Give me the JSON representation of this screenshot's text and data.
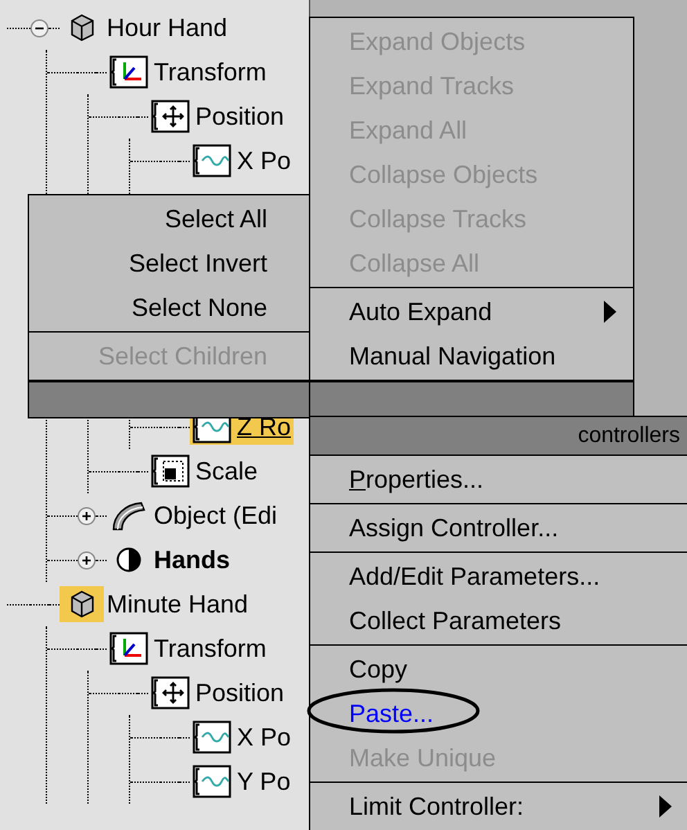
{
  "tree": [
    {
      "label": "Hour Hand",
      "kind": "object",
      "expanded": true,
      "selected": false,
      "focused": false,
      "bold": false,
      "children": [
        {
          "label": "Transform",
          "kind": "transform",
          "selected": false,
          "focused": false,
          "bold": false,
          "children": [
            {
              "label": "Position",
              "kind": "position",
              "selected": false,
              "focused": false,
              "bold": false,
              "children": [
                {
                  "label": "X Po",
                  "kind": "curve",
                  "selected": false,
                  "focused": false,
                  "bold": false
                },
                {
                  "label": "Z Ro",
                  "kind": "curve",
                  "rows_hidden_above": true,
                  "selected": true,
                  "focused": true,
                  "bold": false
                }
              ]
            },
            {
              "label": "Scale",
              "kind": "scale",
              "selected": false,
              "focused": false,
              "bold": false
            }
          ]
        },
        {
          "label": "Object (Edi",
          "kind": "modifier",
          "expanded": false,
          "selected": false,
          "focused": false,
          "bold": false
        },
        {
          "label": "Hands",
          "kind": "group",
          "expanded": false,
          "selected": false,
          "focused": false,
          "bold": true
        }
      ]
    },
    {
      "label": "Minute Hand",
      "kind": "object",
      "selected": true,
      "focused": false,
      "bold": false,
      "children": [
        {
          "label": "Transform",
          "kind": "transform",
          "selected": false,
          "focused": false,
          "bold": false,
          "children": [
            {
              "label": "Position",
              "kind": "position",
              "selected": false,
              "focused": false,
              "bold": false,
              "children": [
                {
                  "label": "X Po",
                  "kind": "curve",
                  "selected": false,
                  "focused": false,
                  "bold": false
                },
                {
                  "label": "Y Po",
                  "kind": "curve",
                  "selected": false,
                  "focused": false,
                  "bold": false
                }
              ]
            }
          ]
        }
      ]
    }
  ],
  "quad_menu": [
    {
      "groups": [
        [
          {
            "label": "Select All",
            "disabled": false,
            "submenu": false,
            "highlighted": false,
            "underline_first": false
          },
          {
            "label": "Select Invert",
            "disabled": false,
            "submenu": false,
            "highlighted": false,
            "underline_first": false
          },
          {
            "label": "Select None",
            "disabled": false,
            "submenu": false,
            "highlighted": false,
            "underline_first": false
          }
        ],
        [
          {
            "label": "Select Children",
            "disabled": true,
            "submenu": false,
            "highlighted": false,
            "underline_first": false
          }
        ]
      ]
    },
    {
      "groups": [
        [
          {
            "label": "Expand Objects",
            "disabled": true,
            "submenu": false,
            "highlighted": false,
            "underline_first": false
          },
          {
            "label": "Expand Tracks",
            "disabled": true,
            "submenu": false,
            "highlighted": false,
            "underline_first": false
          },
          {
            "label": "Expand All",
            "disabled": true,
            "submenu": false,
            "highlighted": false,
            "underline_first": false
          },
          {
            "label": "Collapse Objects",
            "disabled": true,
            "submenu": false,
            "highlighted": false,
            "underline_first": false
          },
          {
            "label": "Collapse Tracks",
            "disabled": true,
            "submenu": false,
            "highlighted": false,
            "underline_first": false
          },
          {
            "label": "Collapse All",
            "disabled": true,
            "submenu": false,
            "highlighted": false,
            "underline_first": false
          }
        ],
        [
          {
            "label": "Auto Expand",
            "disabled": false,
            "submenu": true,
            "highlighted": false,
            "underline_first": false
          },
          {
            "label": "Manual Navigation",
            "disabled": false,
            "submenu": false,
            "highlighted": false,
            "underline_first": false
          }
        ]
      ]
    },
    {
      "title": "controllers",
      "groups": [
        [
          {
            "label": "Properties...",
            "disabled": false,
            "submenu": false,
            "highlighted": false,
            "underline_first": true
          }
        ],
        [
          {
            "label": "Assign Controller...",
            "disabled": false,
            "submenu": false,
            "highlighted": false,
            "underline_first": false
          }
        ],
        [
          {
            "label": "Add/Edit Parameters...",
            "disabled": false,
            "submenu": false,
            "highlighted": false,
            "underline_first": false
          },
          {
            "label": "Collect Parameters",
            "disabled": false,
            "submenu": false,
            "highlighted": false,
            "underline_first": false
          }
        ],
        [
          {
            "label": "Copy",
            "disabled": false,
            "submenu": false,
            "highlighted": false,
            "underline_first": false
          },
          {
            "label": "Paste...",
            "disabled": false,
            "submenu": false,
            "highlighted": true,
            "underline_first": false
          },
          {
            "label": "Make Unique",
            "disabled": true,
            "submenu": false,
            "highlighted": false,
            "underline_first": false
          }
        ],
        [
          {
            "label": "Limit Controller:",
            "disabled": false,
            "submenu": true,
            "highlighted": false,
            "underline_first": false
          }
        ]
      ]
    }
  ]
}
